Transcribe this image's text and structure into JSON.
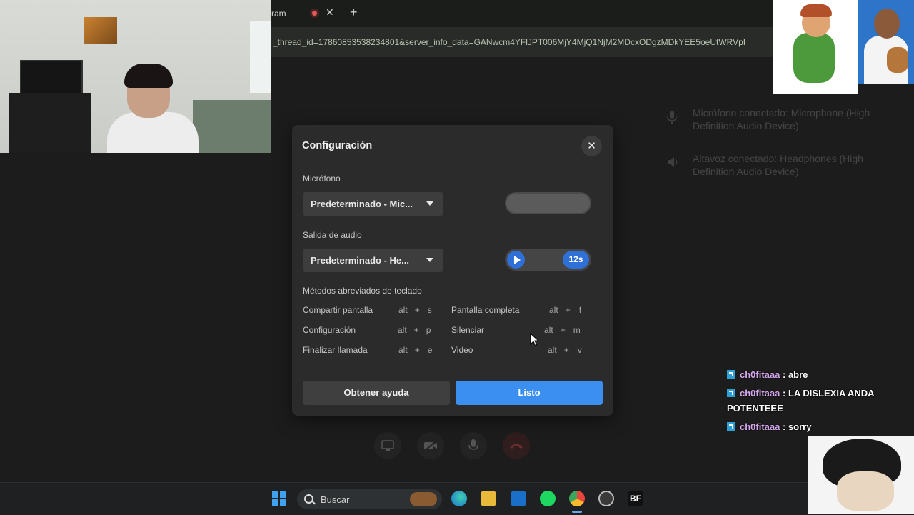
{
  "browser": {
    "tab_title": "ram",
    "tab_close": "✕",
    "new_tab": "+",
    "url": "_thread_id=17860853538234801&server_info_data=GANwcm4YFlJPT006MjY4MjQ1NjM2MDcxODgzMDkYEE5oeUtWRVpI"
  },
  "notifications": [
    {
      "icon": "microphone-icon",
      "text": "Micrófono conectado: Microphone (High Definition Audio Device)"
    },
    {
      "icon": "speaker-icon",
      "text": "Altavoz conectado: Headphones (High Definition Audio Device)"
    }
  ],
  "dialog": {
    "title": "Configuración",
    "close": "✕",
    "mic_label": "Micrófono",
    "mic_value": "Predeterminado - Mic...",
    "output_label": "Salida de audio",
    "output_value": "Predeterminado - He...",
    "test_time": "12s",
    "shortcuts_label": "Métodos abreviados de teclado",
    "shortcuts": [
      {
        "label": "Compartir pantalla",
        "mod": "alt",
        "plus": "+",
        "key": "s"
      },
      {
        "label": "Configuración",
        "mod": "alt",
        "plus": "+",
        "key": "p"
      },
      {
        "label": "Finalizar llamada",
        "mod": "alt",
        "plus": "+",
        "key": "e"
      },
      {
        "label": "Pantalla completa",
        "mod": "alt",
        "plus": "+",
        "key": "f"
      },
      {
        "label": "Silenciar",
        "mod": "alt",
        "plus": "+",
        "key": "m"
      },
      {
        "label": "Video",
        "mod": "alt",
        "plus": "+",
        "key": "v"
      }
    ],
    "help_button": "Obtener ayuda",
    "done_button": "Listo"
  },
  "chat": [
    {
      "user": "ch0fitaaa",
      "sep": " : ",
      "text": "abre"
    },
    {
      "user": "ch0fitaaa",
      "sep": " : ",
      "text": "LA DISLEXIA ANDA POTENTEEE"
    },
    {
      "user": "ch0fitaaa",
      "sep": " : ",
      "text": "sorry"
    }
  ],
  "taskbar": {
    "search_placeholder": "Buscar",
    "bf_label": "BF"
  },
  "colors": {
    "accent": "#3a8ff0",
    "dialog_bg": "#2b2b2b",
    "page_bg": "#1c1c1c",
    "chat_user": "#d7a8f0"
  }
}
